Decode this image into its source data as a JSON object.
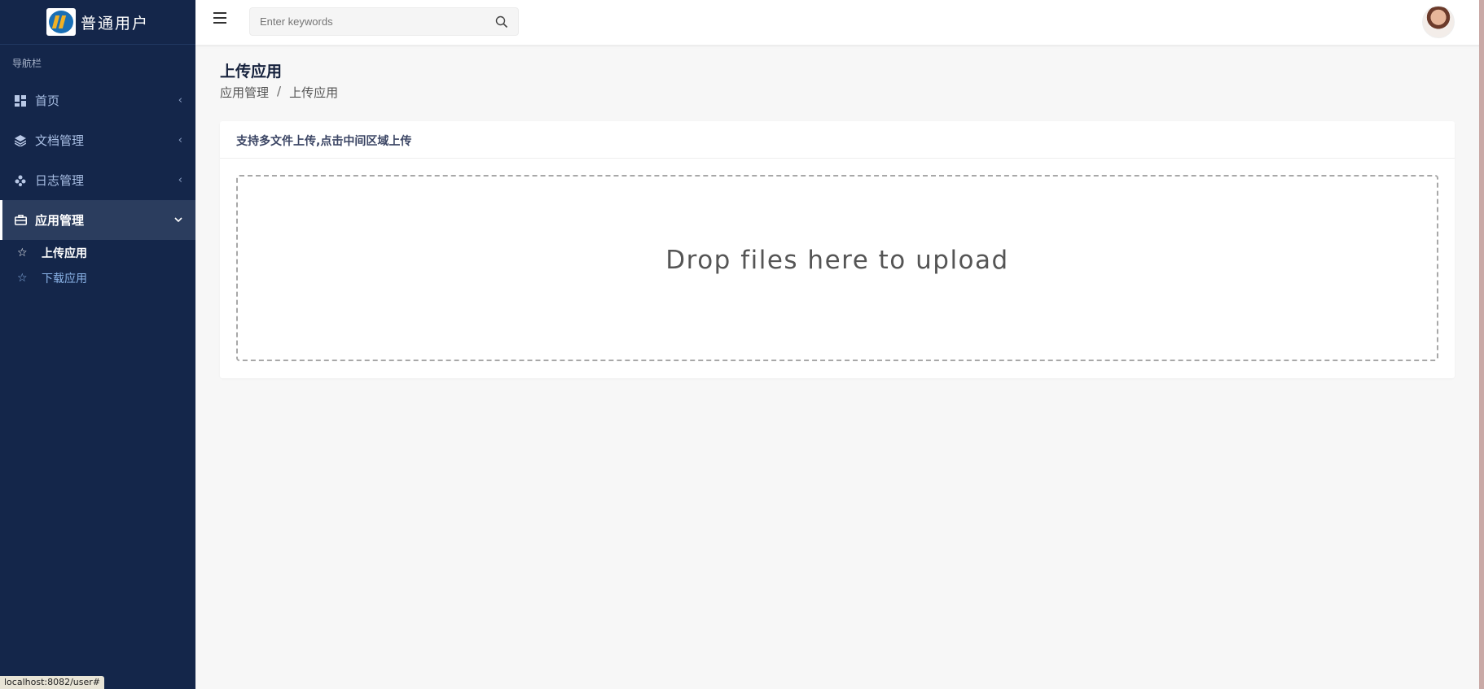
{
  "brand": {
    "title": "普通用户"
  },
  "sidebar": {
    "header": "导航栏",
    "items": [
      {
        "label": "首页",
        "icon": "dashboard-icon"
      },
      {
        "label": "文档管理",
        "icon": "layers-icon"
      },
      {
        "label": "日志管理",
        "icon": "gamepad-icon"
      },
      {
        "label": "应用管理",
        "icon": "briefcase-icon"
      }
    ],
    "subitems": [
      {
        "label": "上传应用"
      },
      {
        "label": "下载应用"
      }
    ]
  },
  "search": {
    "placeholder": "Enter keywords"
  },
  "page": {
    "title": "上传应用",
    "breadcrumb": [
      "应用管理",
      "上传应用"
    ],
    "breadcrumb_sep": "/"
  },
  "card": {
    "header": "支持多文件上传,点击中间区域上传",
    "dropzone_text": "Drop files here to upload"
  },
  "status": {
    "url": "localhost:8082/user#"
  },
  "colors": {
    "sidebar_bg": "#14264a",
    "accent": "#a9bfe4",
    "content_bg": "#f7f7f7"
  }
}
